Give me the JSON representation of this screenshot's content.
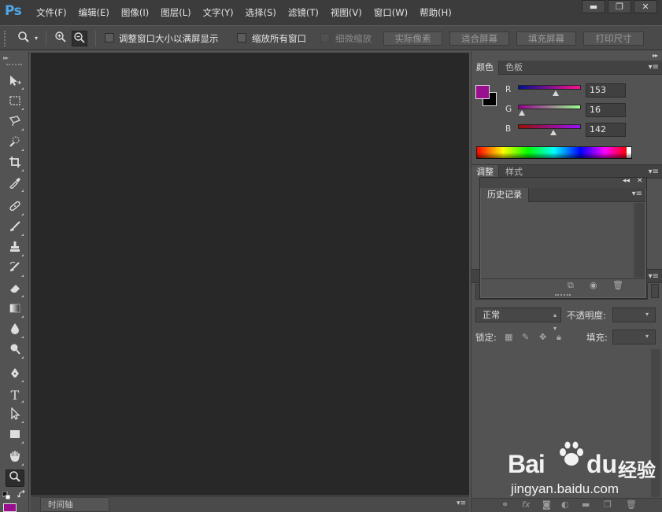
{
  "app": {
    "logo": "Ps"
  },
  "menu": [
    "文件(F)",
    "编辑(E)",
    "图像(I)",
    "图层(L)",
    "文字(Y)",
    "选择(S)",
    "滤镜(T)",
    "视图(V)",
    "窗口(W)",
    "帮助(H)"
  ],
  "window_controls": {
    "minimize": "▬",
    "maximize": "❐",
    "close": "✕"
  },
  "options": {
    "resize_windows": "调整窗口大小以满屏显示",
    "zoom_all": "缩放所有窗口",
    "scrubby_zoom": "细微缩放",
    "actual_pixels": "实际像素",
    "fit_screen": "适合屏幕",
    "fill_screen": "填充屏幕",
    "print_size": "打印尺寸"
  },
  "timeline": {
    "label": "时间轴"
  },
  "color_panel": {
    "tabs": [
      "颜色",
      "色板"
    ],
    "foreground": "#990f8e",
    "background": "#000000",
    "channels": [
      {
        "label": "R",
        "value": "153"
      },
      {
        "label": "G",
        "value": "16"
      },
      {
        "label": "B",
        "value": "142"
      }
    ],
    "channel_levels": [
      0.6,
      0.063,
      0.557
    ]
  },
  "adjust_panel": {
    "tabs": [
      "调整",
      "样式"
    ]
  },
  "history_panel": {
    "title": "历史记录"
  },
  "layers_panel": {
    "blend_mode": "正常",
    "opacity_label": "不透明度:",
    "lock_label": "锁定:",
    "fill_label": "填充:"
  },
  "watermark": {
    "brand": "Bai",
    "brand2": "du",
    "brand_cn": "经验",
    "url": "jingyan.baidu.com"
  }
}
